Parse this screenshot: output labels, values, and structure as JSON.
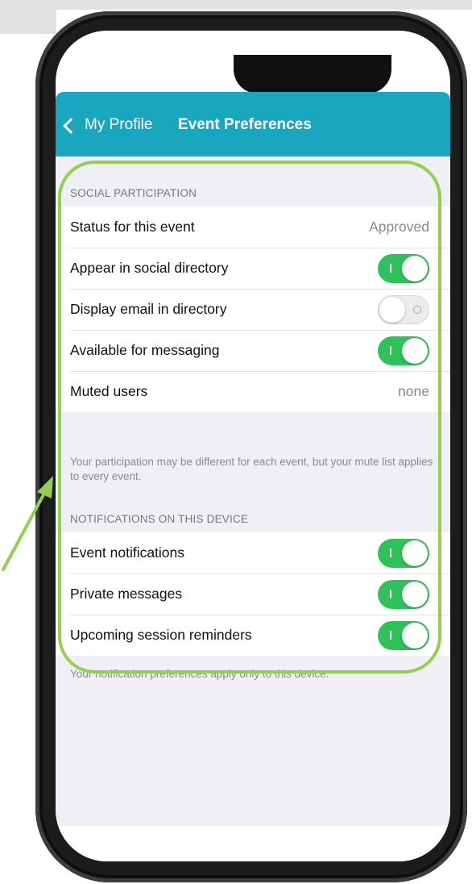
{
  "nav": {
    "back_label": "My Profile",
    "title": "Event Preferences"
  },
  "social": {
    "header": "SOCIAL PARTICIPATION",
    "rows": [
      {
        "label": "Status for this event",
        "value": "Approved"
      },
      {
        "label": "Appear in social directory",
        "toggle": "on"
      },
      {
        "label": "Display email in directory",
        "toggle": "off"
      },
      {
        "label": "Available for messaging",
        "toggle": "on"
      },
      {
        "label": "Muted users",
        "value": "none"
      }
    ],
    "footer": "Your participation may be different for each event, but your mute list applies to every event."
  },
  "notifications": {
    "header": "NOTIFICATIONS ON THIS DEVICE",
    "rows": [
      {
        "label": "Event notifications",
        "toggle": "on"
      },
      {
        "label": "Private messages",
        "toggle": "on"
      },
      {
        "label": "Upcoming session reminders",
        "toggle": "on"
      }
    ],
    "footer": "Your notification preferences apply only to this device."
  },
  "colors": {
    "nav_bar": "#1aa6bf",
    "toggle_on": "#30c25a",
    "highlight": "#92d050"
  }
}
